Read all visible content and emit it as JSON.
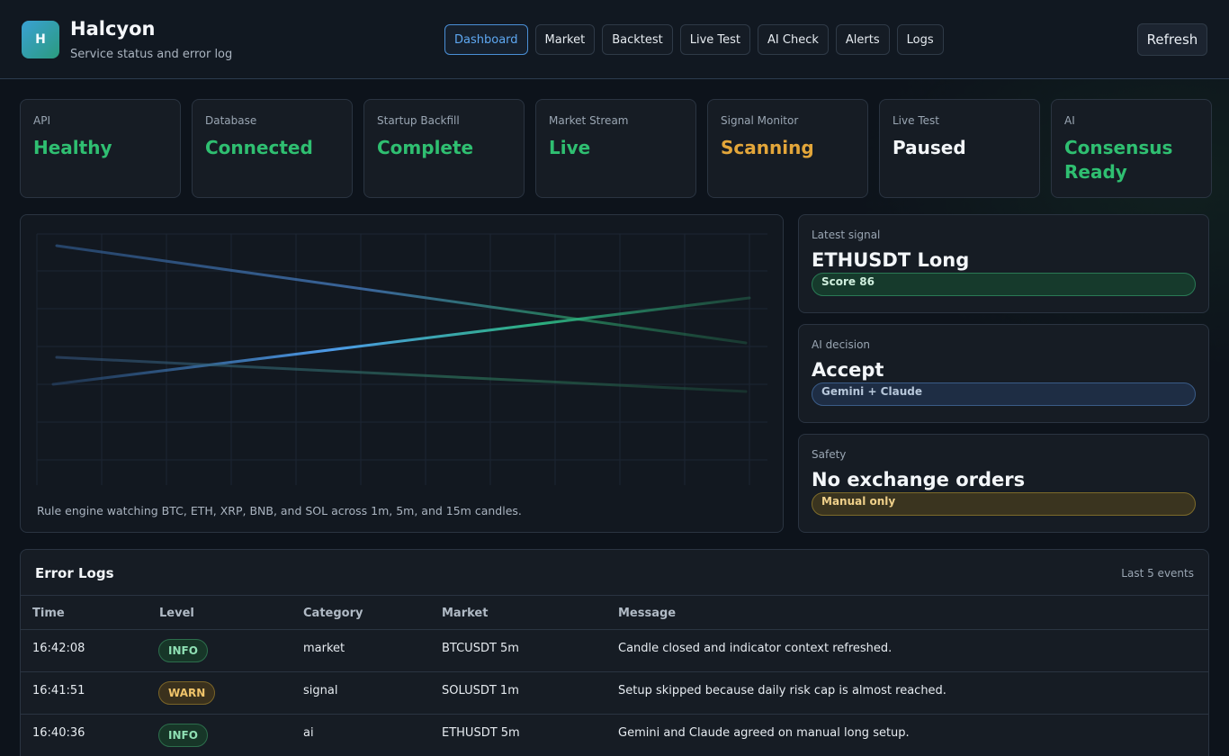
{
  "app": {
    "logo_letter": "H",
    "title": "Halcyon",
    "subtitle": "Service status and error log"
  },
  "nav": {
    "items": [
      {
        "label": "Dashboard",
        "active": true
      },
      {
        "label": "Market",
        "active": false
      },
      {
        "label": "Backtest",
        "active": false
      },
      {
        "label": "Live Test",
        "active": false
      },
      {
        "label": "AI Check",
        "active": false
      },
      {
        "label": "Alerts",
        "active": false
      },
      {
        "label": "Logs",
        "active": false
      }
    ],
    "refresh_label": "Refresh"
  },
  "status": [
    {
      "label": "API",
      "value": "Healthy",
      "color": "#2fbf71"
    },
    {
      "label": "Database",
      "value": "Connected",
      "color": "#2fbf71"
    },
    {
      "label": "Startup Backfill",
      "value": "Complete",
      "color": "#2fbf71"
    },
    {
      "label": "Market Stream",
      "value": "Live",
      "color": "#2fbf71"
    },
    {
      "label": "Signal Monitor",
      "value": "Scanning",
      "color": "#e3a63a"
    },
    {
      "label": "Live Test",
      "value": "Paused",
      "color": "#f3f6f9"
    },
    {
      "label": "AI",
      "value": "Consensus Ready",
      "color": "#2fbf71"
    }
  ],
  "chart": {
    "caption": "Rule engine watching BTC, ETH, XRP, BNB, and SOL across 1m, 5m, and 15m candles."
  },
  "side": {
    "latest_signal": {
      "label": "Latest signal",
      "title": "ETHUSDT Long",
      "pill": "Score 86"
    },
    "ai_decision": {
      "label": "AI decision",
      "title": "Accept",
      "pill": "Gemini + Claude"
    },
    "safety": {
      "label": "Safety",
      "title": "No exchange orders",
      "pill": "Manual only"
    }
  },
  "logs": {
    "title": "Error Logs",
    "count": "Last 5 events",
    "columns": {
      "time": "Time",
      "level": "Level",
      "category": "Category",
      "market": "Market",
      "message": "Message"
    },
    "rows": [
      {
        "time": "16:42:08",
        "level": "INFO",
        "category": "market",
        "market": "BTCUSDT 5m",
        "message": "Candle closed and indicator context refreshed."
      },
      {
        "time": "16:41:51",
        "level": "WARN",
        "category": "signal",
        "market": "SOLUSDT 1m",
        "message": "Setup skipped because daily risk cap is almost reached."
      },
      {
        "time": "16:40:36",
        "level": "INFO",
        "category": "ai",
        "market": "ETHUSDT 5m",
        "message": "Gemini and Claude agreed on manual long setup."
      }
    ]
  },
  "colors": {
    "accent": "#4a8fd6",
    "ok": "#2fbf71",
    "warn": "#e3a63a"
  }
}
